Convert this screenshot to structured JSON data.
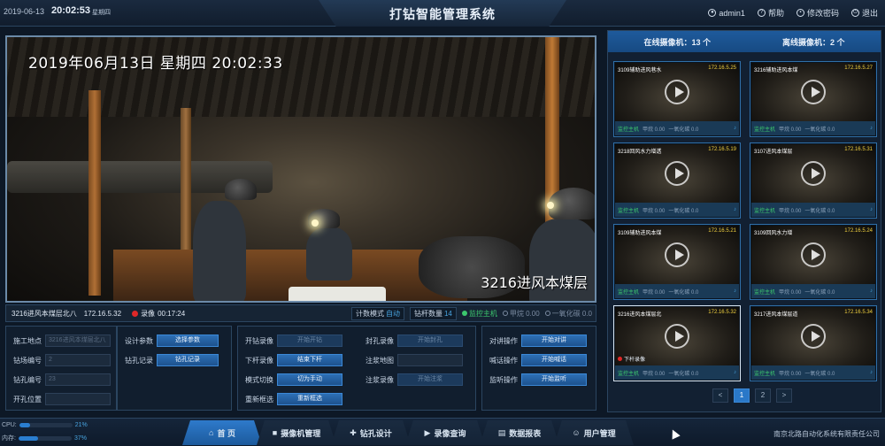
{
  "topbar": {
    "date": "2019-06-13",
    "time": "20:02:53",
    "weekday": "星期四",
    "title": "打钻智能管理系统",
    "user": "admin1",
    "help": "帮助",
    "change_password": "修改密码",
    "logout": "退出"
  },
  "video": {
    "timestamp": "2019年06月13日  星期四  20:02:33",
    "location_overlay": "3216进风本煤层"
  },
  "status": {
    "location": "3216进风本煤层北八",
    "ip": "172.16.5.32",
    "rec_prefix": "录像",
    "rec_time": "00:17:24",
    "count_mode_label": "计数模式",
    "count_mode_value": "自动",
    "rod_count_label": "钻杆数量",
    "rod_count_value": "14",
    "host": "监控主机",
    "methane": "甲烷 0.00",
    "co": "一氧化碳 0.0"
  },
  "controls": {
    "site_label": "施工地点",
    "site_value": "3216进风本煤层北八",
    "field_label": "钻场编号",
    "field_value": "2",
    "hole_label": "钻孔编号",
    "hole_value": "23",
    "pos_label": "开孔位置",
    "pos_value": "",
    "design_label": "设计参数",
    "design_btn": "选择参数",
    "record_label": "钻孔记录",
    "record_btn": "钻孔记录",
    "start_drill_label": "开钻录像",
    "start_drill_btn": "开始开钻",
    "rod_down_label": "下杆录像",
    "rod_down_btn": "结束下杆",
    "mode_label": "模式切换",
    "mode_btn": "切为手动",
    "redetect_label": "重新框选",
    "redetect_btn": "重新框选",
    "seal_label": "封孔录像",
    "seal_btn": "开始封孔",
    "grout_map_label": "注浆地图",
    "grout_map_value": "",
    "grout_label": "注浆录像",
    "grout_btn": "开始注浆",
    "talk_label": "对讲操作",
    "talk_btn": "开始对讲",
    "broadcast_label": "喊话操作",
    "broadcast_btn": "开始喊话",
    "listen_label": "监听操作",
    "listen_btn": "开始监听"
  },
  "cameras_panel": {
    "online_label": "在线摄像机",
    "online_count": "13 个",
    "offline_label": "离线摄像机",
    "offline_count": "2 个",
    "cameras": [
      {
        "name": "3109辅助进风巷水",
        "ip": "172.16.5.25",
        "host": "监控主机",
        "methane": "甲烷 0.00",
        "co": "一氧化碳 0.0"
      },
      {
        "name": "3216辅助进风本煤",
        "ip": "172.16.5.27",
        "host": "监控主机",
        "methane": "甲烷 0.00",
        "co": "一氧化碳 0.0"
      },
      {
        "name": "3218回风水力增透",
        "ip": "172.16.5.19",
        "host": "监控主机",
        "methane": "甲烷 0.00",
        "co": "一氧化碳 0.0"
      },
      {
        "name": "3107进风本煤层",
        "ip": "172.16.5.31",
        "host": "监控主机",
        "methane": "甲烷 0.00",
        "co": "一氧化碳 0.0"
      },
      {
        "name": "3109辅助进风本煤",
        "ip": "172.16.5.21",
        "host": "监控主机",
        "methane": "甲烷 0.00",
        "co": "一氧化碳 0.0"
      },
      {
        "name": "3109回风水力增",
        "ip": "172.16.5.24",
        "host": "监控主机",
        "methane": "甲烷 0.00",
        "co": "一氧化碳 0.0"
      },
      {
        "name": "3216进风本煤层北",
        "ip": "172.16.5.32",
        "host": "监控主机",
        "methane": "甲烷 0.00",
        "co": "一氧化碳 0.0",
        "rec": "下杆录像"
      },
      {
        "name": "3217进风本煤层道",
        "ip": "172.16.5.34",
        "host": "监控主机",
        "methane": "甲烷 0.00",
        "co": "一氧化碳 0.0"
      }
    ],
    "pager": {
      "prev": "<",
      "p1": "1",
      "p2": "2",
      "next": ">"
    }
  },
  "bottom": {
    "cpu_label": "CPU:",
    "cpu_value": "21%",
    "cpu_level": 21,
    "mem_label": "内存:",
    "mem_value": "37%",
    "mem_level": 37,
    "tabs": [
      {
        "label": "首 页",
        "icon": "home-icon"
      },
      {
        "label": "摄像机管理",
        "icon": "camera-icon"
      },
      {
        "label": "钻孔设计",
        "icon": "drill-icon"
      },
      {
        "label": "录像查询",
        "icon": "video-icon"
      },
      {
        "label": "数据报表",
        "icon": "report-icon"
      },
      {
        "label": "用户管理",
        "icon": "users-icon"
      }
    ],
    "company": "南京北路自动化系统有限责任公司"
  }
}
